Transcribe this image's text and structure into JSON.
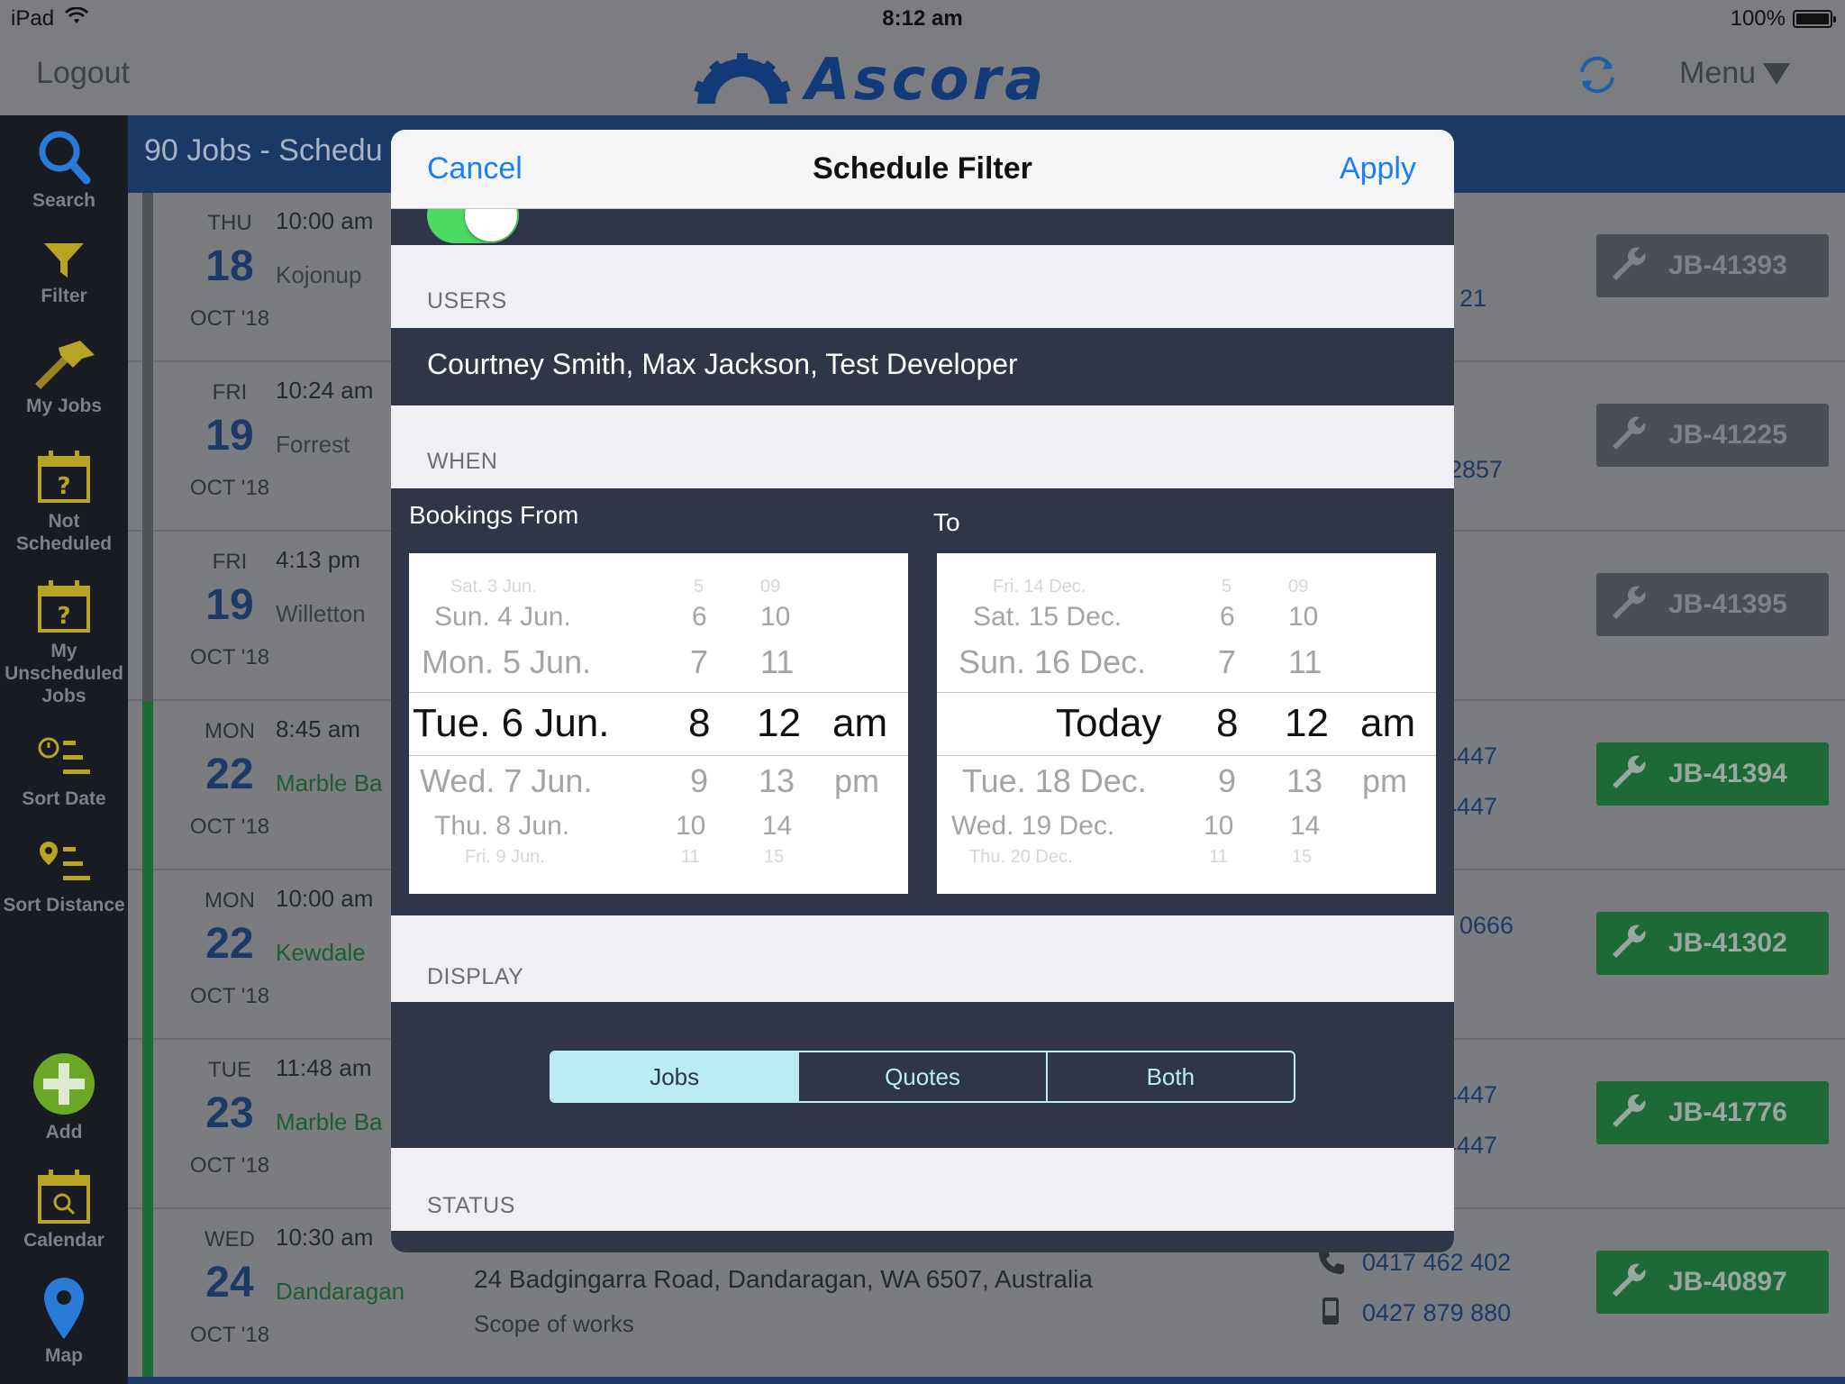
{
  "status_bar": {
    "device": "iPad",
    "time": "8:12 am",
    "battery": "100%"
  },
  "top_nav": {
    "logout": "Logout",
    "logo_text": "Ascora",
    "menu": "Menu"
  },
  "sidebar": {
    "items": [
      {
        "label": "Search",
        "icon": "search-icon"
      },
      {
        "label": "Filter",
        "icon": "filter-icon"
      },
      {
        "label": "My Jobs",
        "icon": "hammer-icon"
      },
      {
        "label": "Not Scheduled",
        "icon": "calendar-question-icon"
      },
      {
        "label": "My Unscheduled Jobs",
        "icon": "calendar-question-icon"
      },
      {
        "label": "Sort Date",
        "icon": "clock-list-icon"
      },
      {
        "label": "Sort Distance",
        "icon": "pin-list-icon"
      },
      {
        "label": "Add",
        "icon": "plus-circle-icon"
      },
      {
        "label": "Calendar",
        "icon": "calendar-search-icon"
      },
      {
        "label": "Map",
        "icon": "map-pin-icon"
      }
    ]
  },
  "list": {
    "header": "90 Jobs - Schedu",
    "rows": [
      {
        "dow": "THU",
        "day": "18",
        "month": "OCT '18",
        "time": "10:00 am",
        "suburb": "Kojonup",
        "phone1": "21",
        "phone2": "",
        "job": "JB-41393",
        "status": "grey"
      },
      {
        "dow": "FRI",
        "day": "19",
        "month": "OCT '18",
        "time": "10:24 am",
        "suburb": "Forrest",
        "phone1": "2857",
        "phone2": "",
        "job": "JB-41225",
        "status": "grey"
      },
      {
        "dow": "FRI",
        "day": "19",
        "month": "OCT '18",
        "time": "4:13 pm",
        "suburb": "Willetton",
        "phone1": "",
        "phone2": "",
        "job": "JB-41395",
        "status": "grey"
      },
      {
        "dow": "MON",
        "day": "22",
        "month": "OCT '18",
        "time": "8:45 am",
        "suburb": "Marble Ba",
        "phone1": "4447",
        "phone2": "4447",
        "job": "JB-41394",
        "status": "green"
      },
      {
        "dow": "MON",
        "day": "22",
        "month": "OCT '18",
        "time": "10:00 am",
        "suburb": "Kewdale",
        "phone1": "0666",
        "phone2": "",
        "job": "JB-41302",
        "status": "green"
      },
      {
        "dow": "TUE",
        "day": "23",
        "month": "OCT '18",
        "time": "11:48 am",
        "suburb": "Marble Ba",
        "phone1": "4447",
        "phone2": "4447",
        "job": "JB-41776",
        "status": "green"
      },
      {
        "dow": "WED",
        "day": "24",
        "month": "OCT '18",
        "time": "10:30 am",
        "suburb": "Dandaragan",
        "address": "24 Badgingarra Road, Dandaragan, WA 6507, Australia",
        "scope": "Scope of works",
        "phone1": "0417 462 402",
        "phone2": "0427 879 880",
        "job": "JB-40897",
        "status": "green"
      }
    ]
  },
  "modal": {
    "cancel": "Cancel",
    "title": "Schedule Filter",
    "apply": "Apply",
    "users_label": "USERS",
    "users_value": "Courtney Smith, Max Jackson, Test Developer",
    "when_label": "WHEN",
    "from_label": "Bookings From",
    "to_label": "To",
    "from_picker": {
      "dates": [
        "Sat. 3 Jun.",
        "Sun. 4 Jun.",
        "Mon. 5 Jun.",
        "Tue. 6 Jun.",
        "Wed. 7 Jun.",
        "Thu. 8 Jun.",
        "Fri. 9 Jun."
      ],
      "hours": [
        "5",
        "6",
        "7",
        "8",
        "9",
        "10",
        "11"
      ],
      "minutes": [
        "09",
        "10",
        "11",
        "12",
        "13",
        "14",
        "15"
      ],
      "ampm": [
        "",
        "",
        "",
        "am",
        "pm",
        "",
        ""
      ]
    },
    "to_picker": {
      "dates": [
        "Fri. 14 Dec.",
        "Sat. 15 Dec.",
        "Sun. 16 Dec.",
        "Today",
        "Tue. 18 Dec.",
        "Wed. 19 Dec.",
        "Thu. 20 Dec."
      ],
      "hours": [
        "5",
        "6",
        "7",
        "8",
        "9",
        "10",
        "11"
      ],
      "minutes": [
        "09",
        "10",
        "11",
        "12",
        "13",
        "14",
        "15"
      ],
      "ampm": [
        "",
        "",
        "",
        "am",
        "pm",
        "",
        ""
      ]
    },
    "display_label": "DISPLAY",
    "display_options": [
      "Jobs",
      "Quotes",
      "Both"
    ],
    "display_selected": "Jobs",
    "status_label": "STATUS",
    "toggle_on": true
  },
  "colors": {
    "accent": "#1a7ff5",
    "navy": "#1c3a68",
    "green": "#1d6a36",
    "toggle": "#4cd964",
    "segment": "#b9ecf4",
    "panel": "#2f364a"
  }
}
